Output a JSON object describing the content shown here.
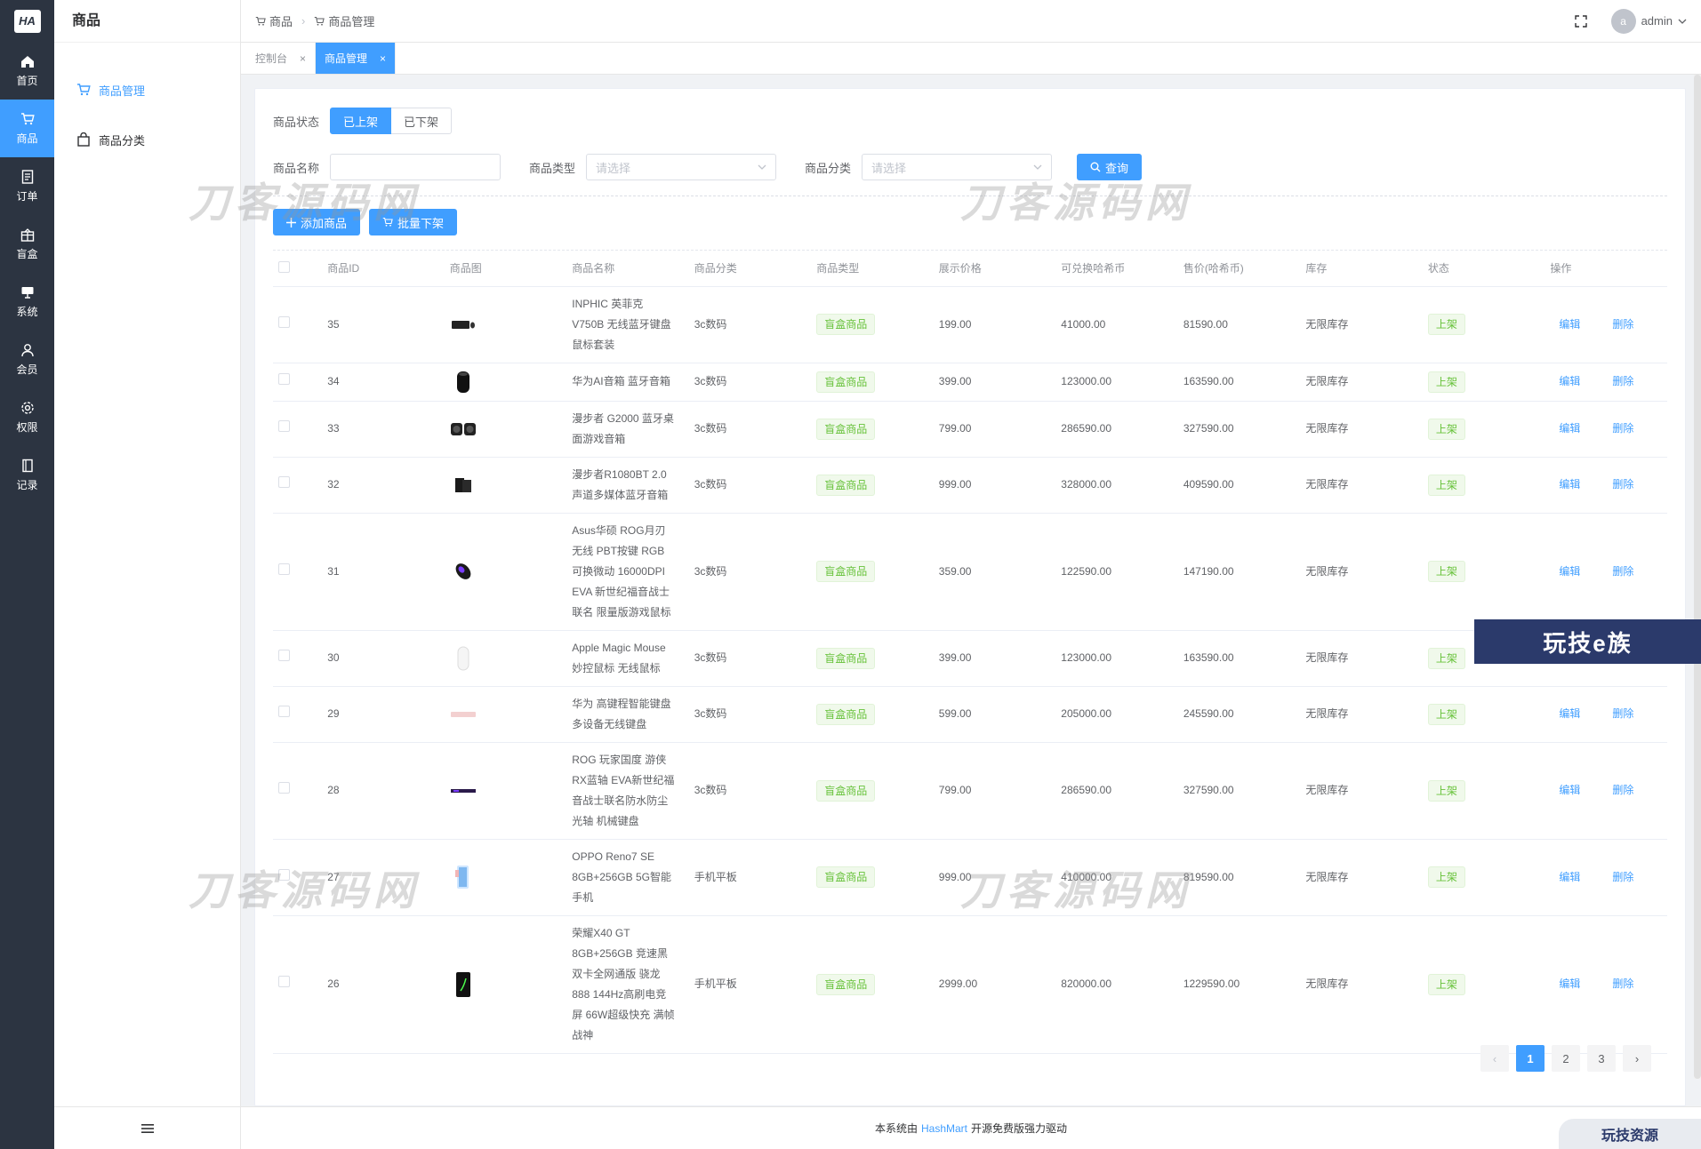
{
  "rail": {
    "logo": "HA",
    "items": [
      {
        "label": "首页",
        "icon": "home-icon",
        "active": false
      },
      {
        "label": "商品",
        "icon": "cart-icon",
        "active": true
      },
      {
        "label": "订单",
        "icon": "document-icon",
        "active": false
      },
      {
        "label": "盲盒",
        "icon": "gift-box-icon",
        "active": false
      },
      {
        "label": "系统",
        "icon": "monitor-icon",
        "active": false
      },
      {
        "label": "会员",
        "icon": "user-icon",
        "active": false
      },
      {
        "label": "权限",
        "icon": "gear-icon",
        "active": false
      },
      {
        "label": "记录",
        "icon": "book-icon",
        "active": false
      }
    ]
  },
  "submenu": {
    "title": "商品",
    "items": [
      {
        "label": "商品管理",
        "icon": "cart-icon",
        "active": true
      },
      {
        "label": "商品分类",
        "icon": "bag-icon",
        "active": false
      }
    ]
  },
  "header": {
    "breadcrumb": [
      "商品",
      "商品管理"
    ],
    "avatar_letter": "a",
    "user": "admin"
  },
  "tags": [
    {
      "label": "控制台",
      "active": false
    },
    {
      "label": "商品管理",
      "active": true
    }
  ],
  "filters": {
    "status_label": "商品状态",
    "status_on": "已上架",
    "status_off": "已下架",
    "name_label": "商品名称",
    "name_value": "",
    "type_label": "商品类型",
    "type_placeholder": "请选择",
    "category_label": "商品分类",
    "category_placeholder": "请选择",
    "query_button": "查询"
  },
  "actions": {
    "add_button": "添加商品",
    "batch_button": "批量下架"
  },
  "table": {
    "columns": [
      "商品ID",
      "商品图",
      "商品名称",
      "商品分类",
      "商品类型",
      "展示价格",
      "可兑换哈希币",
      "售价(哈希币)",
      "库存",
      "状态",
      "操作"
    ],
    "edit_label": "编辑",
    "delete_label": "删除",
    "rows": [
      {
        "id": "35",
        "image": "keyboard-mouse-set",
        "name": "INPHIC 英菲克 V750B 无线蓝牙键盘鼠标套装",
        "category": "3c数码",
        "type": "盲盒商品",
        "display_price": "199.00",
        "exchange": "41000.00",
        "price": "81590.00",
        "stock": "无限库存",
        "status": "上架"
      },
      {
        "id": "34",
        "image": "speaker",
        "name": "华为AI音箱 蓝牙音箱",
        "category": "3c数码",
        "type": "盲盒商品",
        "display_price": "399.00",
        "exchange": "123000.00",
        "price": "163590.00",
        "stock": "无限库存",
        "status": "上架"
      },
      {
        "id": "33",
        "image": "stereo-speakers",
        "name": "漫步者 G2000 蓝牙桌面游戏音箱",
        "category": "3c数码",
        "type": "盲盒商品",
        "display_price": "799.00",
        "exchange": "286590.00",
        "price": "327590.00",
        "stock": "无限库存",
        "status": "上架"
      },
      {
        "id": "32",
        "image": "bookshelf-speakers",
        "name": "漫步者R1080BT 2.0声道多媒体蓝牙音箱",
        "category": "3c数码",
        "type": "盲盒商品",
        "display_price": "999.00",
        "exchange": "328000.00",
        "price": "409590.00",
        "stock": "无限库存",
        "status": "上架"
      },
      {
        "id": "31",
        "image": "gaming-mouse",
        "name": "Asus华硕 ROG月刃 无线 PBT按键 RGB可换微动 16000DPI EVA 新世纪福音战士联名 限量版游戏鼠标",
        "category": "3c数码",
        "type": "盲盒商品",
        "display_price": "359.00",
        "exchange": "122590.00",
        "price": "147190.00",
        "stock": "无限库存",
        "status": "上架"
      },
      {
        "id": "30",
        "image": "magic-mouse",
        "name": "Apple Magic Mouse 妙控鼠标 无线鼠标",
        "category": "3c数码",
        "type": "盲盒商品",
        "display_price": "399.00",
        "exchange": "123000.00",
        "price": "163590.00",
        "stock": "无限库存",
        "status": "上架"
      },
      {
        "id": "29",
        "image": "pink-keyboard",
        "name": "华为 高键程智能键盘 多设备无线键盘",
        "category": "3c数码",
        "type": "盲盒商品",
        "display_price": "599.00",
        "exchange": "205000.00",
        "price": "245590.00",
        "stock": "无限库存",
        "status": "上架"
      },
      {
        "id": "28",
        "image": "purple-keyboard",
        "name": "ROG 玩家国度 游侠RX蓝轴 EVA新世纪福音战士联名防水防尘光轴 机械键盘",
        "category": "3c数码",
        "type": "盲盒商品",
        "display_price": "799.00",
        "exchange": "286590.00",
        "price": "327590.00",
        "stock": "无限库存",
        "status": "上架"
      },
      {
        "id": "27",
        "image": "oppo-phone",
        "name": "OPPO Reno7 SE 8GB+256GB 5G智能手机",
        "category": "手机平板",
        "type": "盲盒商品",
        "display_price": "999.00",
        "exchange": "410000.00",
        "price": "819590.00",
        "stock": "无限库存",
        "status": "上架"
      },
      {
        "id": "26",
        "image": "honor-phone",
        "name": "荣耀X40 GT 8GB+256GB 竞速黑 双卡全网通版 骁龙888 144Hz高刷电竞屏 66W超级快充 满帧战神",
        "category": "手机平板",
        "type": "盲盒商品",
        "display_price": "2999.00",
        "exchange": "820000.00",
        "price": "1229590.00",
        "stock": "无限库存",
        "status": "上架"
      }
    ]
  },
  "pagination": {
    "pages": [
      "1",
      "2",
      "3"
    ],
    "current": "1",
    "prev": "‹",
    "next": "›"
  },
  "footer": {
    "prefix": "本系统由",
    "brand": "HashMart",
    "suffix": "开源免费版强力驱动"
  },
  "watermarks": {
    "text": "刀客源码网",
    "promo": "玩技e族",
    "promo_small": "玩技资源"
  },
  "colors": {
    "primary": "#409eff",
    "rail_bg": "#2c3441",
    "success": "#67c23a"
  }
}
